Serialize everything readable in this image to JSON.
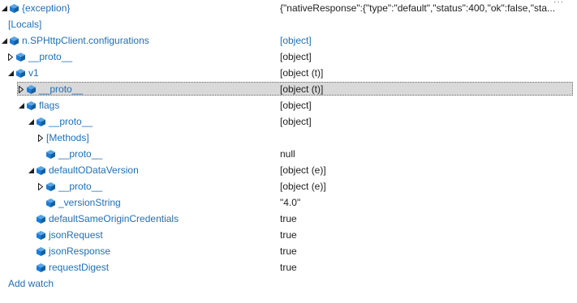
{
  "watch": {
    "add_watch_label": "Add watch",
    "rows": [
      {
        "name": "{exception}",
        "value": "{\"nativeResponse\":{\"type\":\"default\",\"status\":400,\"ok\":false,\"sta...",
        "value_color": "dark"
      },
      {
        "name": "[Locals]",
        "value": "",
        "value_color": "dark"
      },
      {
        "name": "n.SPHttpClient.configurations",
        "value": "[object]",
        "value_color": "blue"
      },
      {
        "name": "__proto__",
        "value": "[object]",
        "value_color": "dark"
      },
      {
        "name": "v1",
        "value": "[object (t)]",
        "value_color": "dark"
      },
      {
        "name": "__proto__",
        "value": "[object (t)]",
        "value_color": "dark"
      },
      {
        "name": "flags",
        "value": "[object]",
        "value_color": "dark"
      },
      {
        "name": "__proto__",
        "value": "[object]",
        "value_color": "dark"
      },
      {
        "name": "[Methods]",
        "value": "",
        "value_color": "dark"
      },
      {
        "name": "__proto__",
        "value": "null",
        "value_color": "dark"
      },
      {
        "name": "defaultODataVersion",
        "value": "[object (e)]",
        "value_color": "dark"
      },
      {
        "name": "__proto__",
        "value": "[object (e)]",
        "value_color": "dark"
      },
      {
        "name": "_versionString",
        "value": "\"4.0\"",
        "value_color": "dark"
      },
      {
        "name": "defaultSameOriginCredentials",
        "value": "true",
        "value_color": "dark"
      },
      {
        "name": "jsonRequest",
        "value": "true",
        "value_color": "dark"
      },
      {
        "name": "jsonResponse",
        "value": "true",
        "value_color": "dark"
      },
      {
        "name": "requestDigest",
        "value": "true",
        "value_color": "dark"
      }
    ]
  },
  "colors": {
    "link": "#1f6fb4",
    "selection": "#d9d9d9",
    "text": "#1e1e1e",
    "icon": "#1c7cd5"
  }
}
